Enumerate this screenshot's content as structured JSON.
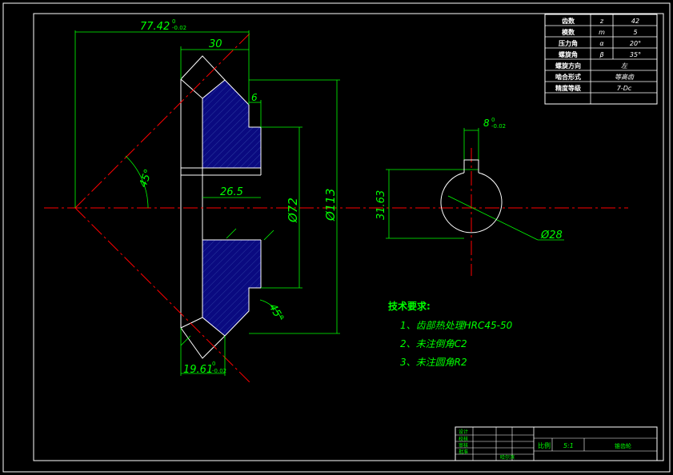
{
  "dimensions": {
    "width_total": "77.42",
    "width_total_tol_upper": "0",
    "width_total_tol_lower": "-0.02",
    "face_width": "30",
    "step_6": "6",
    "hub_length": "26.5",
    "bore_dia": "Ø72",
    "outer_dia": "Ø113",
    "keyway_width": "8",
    "keyway_tol_upper": "0",
    "keyway_tol_lower": "-0.02",
    "keyway_depth": "31.63",
    "shaft_dia": "Ø28",
    "cone_dim": "19.61",
    "cone_dim_tol_upper": "0",
    "cone_dim_tol_lower": "-0.02",
    "angle_cone": "45°",
    "angle_chamfer": "45°"
  },
  "param_table": [
    {
      "name": "齿数",
      "symbol": "z",
      "value": "42"
    },
    {
      "name": "模数",
      "symbol": "m",
      "value": "5"
    },
    {
      "name": "压力角",
      "symbol": "α",
      "value": "20°"
    },
    {
      "name": "螺旋角",
      "symbol": "β",
      "value": "35°"
    },
    {
      "name": "螺旋方向",
      "symbol": "",
      "value": "左"
    },
    {
      "name": "啮合形式",
      "symbol": "",
      "value": "等高齿"
    },
    {
      "name": "精度等级",
      "symbol": "",
      "value": "7-Dc"
    }
  ],
  "tech_requirements": {
    "title": "技术要求:",
    "items": [
      "1、齿部热处理HRC45-50",
      "2、未注倒角C2",
      "3、未注圆角R2"
    ]
  },
  "title_block": {
    "row_labels": [
      "设计",
      "校核",
      "审核",
      "批准"
    ],
    "scale_label": "比例",
    "scale_value": "5:1",
    "part_name": "锥齿轮",
    "org_text": "哈尔滨"
  },
  "colors": {
    "background": "#000000",
    "lines": "#ffffff",
    "dimension": "#00ff00",
    "centerline": "#ff0000",
    "hatch": "#0a0a80"
  }
}
